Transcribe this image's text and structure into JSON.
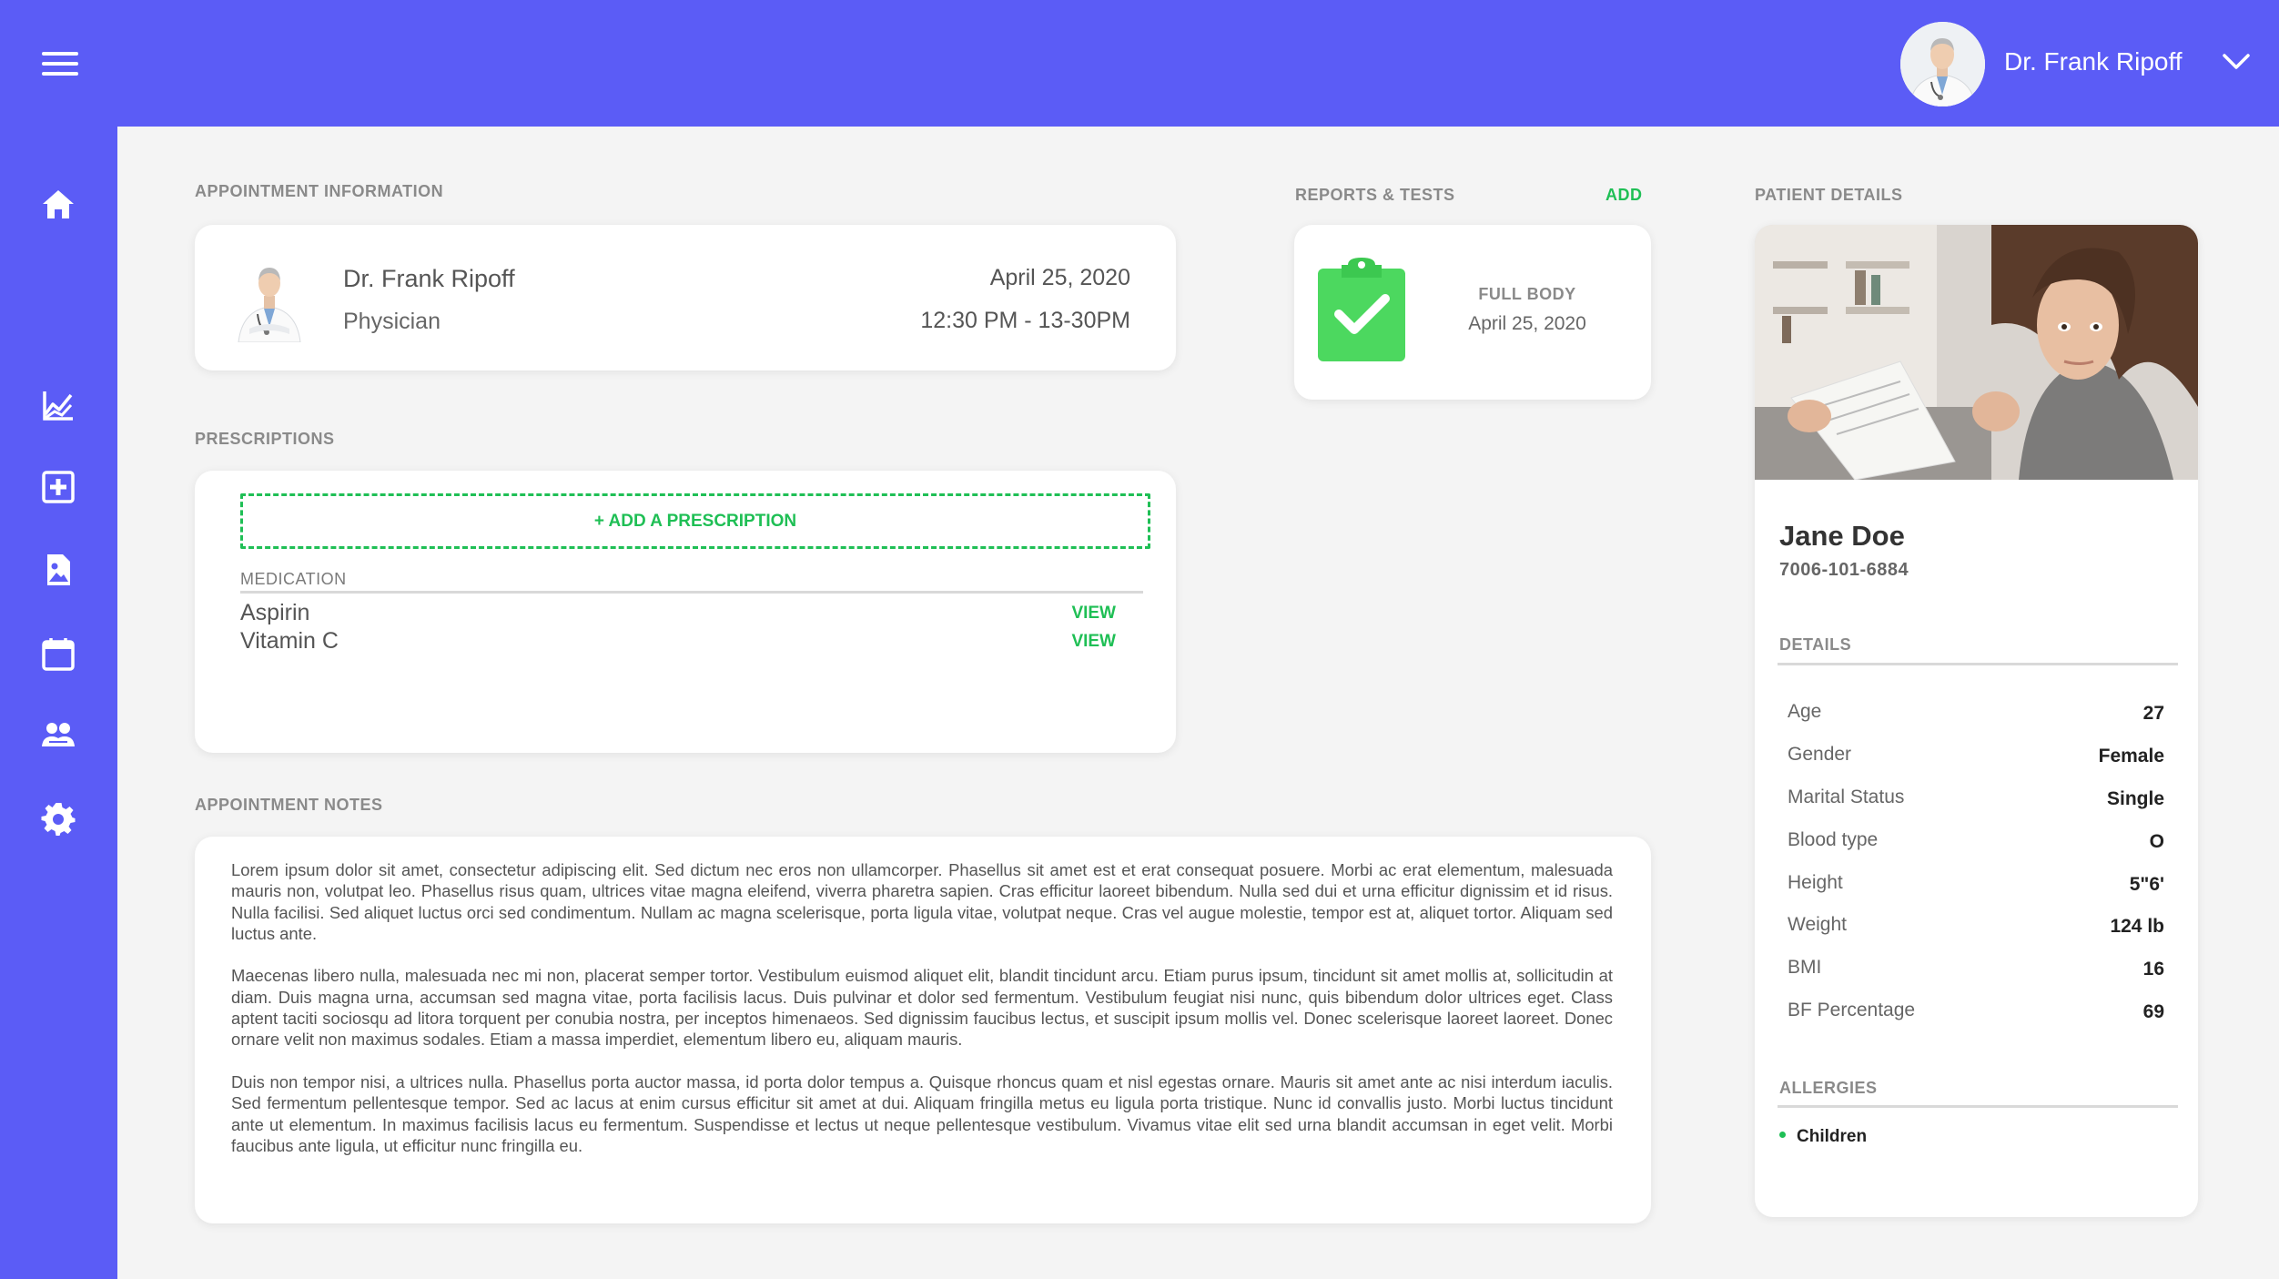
{
  "header": {
    "user_name": "Dr. Frank Ripoff",
    "accent_color": "#5b5cf6"
  },
  "sidebar": {
    "items": [
      {
        "icon": "home-icon"
      },
      {
        "icon": "chart-icon"
      },
      {
        "icon": "medical-box-icon"
      },
      {
        "icon": "image-file-icon"
      },
      {
        "icon": "calendar-icon"
      },
      {
        "icon": "people-icon"
      },
      {
        "icon": "gear-icon"
      }
    ]
  },
  "appointment": {
    "section_label": "APPOINTMENT INFORMATION",
    "doctor_name": "Dr. Frank Ripoff",
    "doctor_role": "Physician",
    "date": "April 25, 2020",
    "time": "12:30 PM - 13-30PM"
  },
  "reports": {
    "section_label": "REPORTS & TESTS",
    "add_label": "ADD",
    "items": [
      {
        "title": "FULL BODY",
        "date": "April 25, 2020"
      }
    ]
  },
  "prescriptions": {
    "section_label": "PRESCRIPTIONS",
    "add_button": "+ ADD A PRESCRIPTION",
    "column_header": "MEDICATION",
    "items": [
      {
        "name": "Aspirin",
        "action": "VIEW"
      },
      {
        "name": "Vitamin C",
        "action": "VIEW"
      }
    ]
  },
  "notes": {
    "section_label": "APPOINTMENT NOTES",
    "paragraphs": [
      "Lorem ipsum dolor sit amet, consectetur adipiscing elit. Sed dictum nec eros non ullamcorper. Phasellus sit amet est et erat consequat posuere. Morbi ac erat elementum, malesuada mauris non, volutpat leo. Phasellus risus quam, ultrices vitae magna eleifend, viverra pharetra sapien. Cras efficitur laoreet bibendum. Nulla sed dui et urna efficitur dignissim et id risus. Nulla facilisi. Sed aliquet luctus orci sed condimentum. Nullam ac magna scelerisque, porta ligula vitae, volutpat neque. Cras vel augue molestie, tempor est at, aliquet tortor. Aliquam sed luctus ante.",
      "Maecenas libero nulla, malesuada nec mi non, placerat semper tortor. Vestibulum euismod aliquet elit, blandit tincidunt arcu. Etiam purus ipsum, tincidunt sit amet mollis at, sollicitudin at diam. Duis magna urna, accumsan sed magna vitae, porta facilisis lacus. Duis pulvinar et dolor sed fermentum. Vestibulum feugiat nisi nunc, quis bibendum dolor ultrices eget. Class aptent taciti sociosqu ad litora torquent per conubia nostra, per inceptos himenaeos. Sed dignissim faucibus lectus, et suscipit ipsum mollis vel. Donec scelerisque laoreet laoreet. Donec ornare velit non maximus sodales. Etiam a massa imperdiet, elementum libero eu, aliquam mauris.",
      "Duis non tempor nisi, a ultrices nulla. Phasellus porta auctor massa, id porta dolor tempus a. Quisque rhoncus quam et nisl egestas ornare. Mauris sit amet ante ac nisi interdum iaculis. Sed fermentum pellentesque tempor. Sed ac lacus at enim cursus efficitur sit amet at dui. Aliquam fringilla metus eu ligula porta tristique. Nunc id convallis justo. Morbi luctus tincidunt ante ut elementum. In maximus facilisis lacus eu fermentum. Suspendisse et lectus ut neque pellentesque vestibulum. Vivamus vitae elit sed urna blandit accumsan in eget velit. Morbi faucibus ante ligula, ut efficitur nunc fringilla eu."
    ]
  },
  "patient": {
    "section_label": "PATIENT DETAILS",
    "name": "Jane Doe",
    "id": "7006-101-6884",
    "details_label": "DETAILS",
    "details": [
      {
        "key": "Age",
        "value": "27"
      },
      {
        "key": "Gender",
        "value": "Female"
      },
      {
        "key": "Marital Status",
        "value": "Single"
      },
      {
        "key": "Blood type",
        "value": "O"
      },
      {
        "key": "Height",
        "value": "5\"6'"
      },
      {
        "key": "Weight",
        "value": "124 lb"
      },
      {
        "key": "BMI",
        "value": "16"
      },
      {
        "key": "BF Percentage",
        "value": "69"
      }
    ],
    "allergies_label": "ALLERGIES",
    "allergies": [
      "Children"
    ]
  }
}
